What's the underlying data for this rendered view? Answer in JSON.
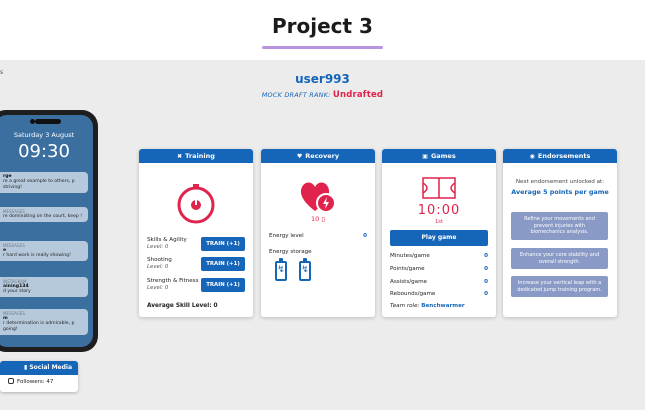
{
  "header": {
    "title": "Project 3"
  },
  "sidebar_fragment": "s",
  "profile": {
    "username": "user993",
    "rank_label": "MOCK DRAFT RANK:",
    "rank_value": "Undrafted"
  },
  "phone": {
    "date": "Saturday 3 August",
    "time": "09:30",
    "notifications": [
      {
        "source": "",
        "sender": "rge",
        "message": "re a great example to others, p striving!"
      },
      {
        "source": "MESSAGES",
        "sender": "",
        "message": "re dominating on the court, keep !"
      },
      {
        "source": "MESSAGES",
        "sender": "e",
        "message": "r hard work is really showing!"
      },
      {
        "source": "INSTAGRAM",
        "sender": "aining134",
        "message": "d your story"
      },
      {
        "source": "MESSAGES",
        "sender": "m",
        "message": "r determination is admirable, p going!"
      }
    ]
  },
  "social": {
    "title": "Social Media",
    "followers": "Followers: 47"
  },
  "training": {
    "title": "Training",
    "skills": [
      {
        "name": "Skills & Agility",
        "level": "Level: 0",
        "button": "TRAIN (+1)"
      },
      {
        "name": "Shooting",
        "level": "Level: 0",
        "button": "TRAIN (+1)"
      },
      {
        "name": "Strength & Fitness",
        "level": "Level: 0",
        "button": "TRAIN (+1)"
      }
    ],
    "average": "Average Skill Level: 0"
  },
  "recovery": {
    "title": "Recovery",
    "energy_value": "10",
    "energy_level_label": "Energy level",
    "energy_level_value": "0",
    "energy_storage_label": "Energy storage"
  },
  "games": {
    "title": "Games",
    "next_game_time": "10:00",
    "next_game_sub": "1st",
    "play_label": "Play game",
    "stats": [
      {
        "label": "Minutes/game",
        "value": "0"
      },
      {
        "label": "Points/game",
        "value": "0"
      },
      {
        "label": "Assists/game",
        "value": "0"
      },
      {
        "label": "Rebounds/game",
        "value": "0"
      }
    ],
    "team_role_label": "Team role:",
    "team_role_value": "Benchwarmer"
  },
  "endorsements": {
    "title": "Endorsements",
    "next_text": "Next endorsement unlocked at:",
    "goal": "Average 5 points per game",
    "items": [
      "Refine your movements and prevent injuries with biomechanics analysis.",
      "Enhance your core stability and overall strength.",
      "Increase your vertical leap with a dedicated jump training program."
    ]
  },
  "colors": {
    "primary": "#1565b8",
    "accent": "#e0234c",
    "underline": "#b894e0",
    "endorsement_box": "#8a9ac6"
  }
}
